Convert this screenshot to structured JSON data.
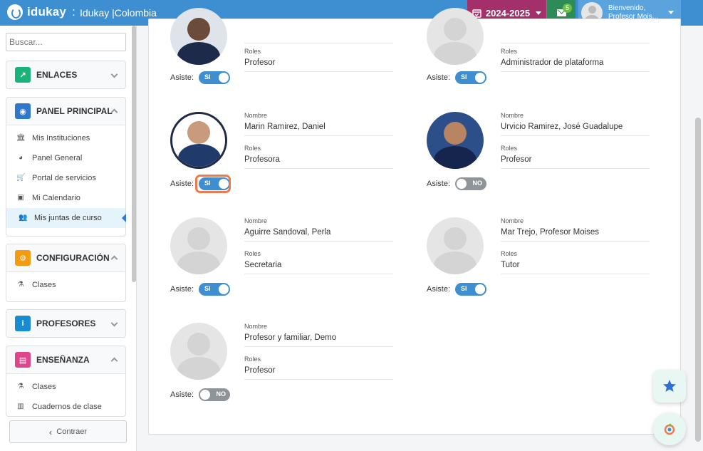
{
  "header": {
    "brand": "idukay",
    "separator": ":",
    "school": "Idukay |Colombia",
    "year": "2024-2025",
    "mail_count": "5",
    "welcome": "Bienvenido,",
    "user_name": "Profesor Mois..."
  },
  "sidebar": {
    "search_placeholder": "Buscar...",
    "back_label": "Contraer",
    "panels": {
      "enlaces": {
        "title": "ENLACES",
        "color": "#1bb37a"
      },
      "principal": {
        "title": "PANEL PRINCIPAL",
        "color": "#2e77c9",
        "items": [
          "Mis Instituciones",
          "Panel General",
          "Portal de servicios",
          "Mi Calendario",
          "Mis juntas de curso"
        ]
      },
      "config": {
        "title": "CONFIGURACIÓN",
        "color": "#f39c12",
        "items": [
          "Clases"
        ]
      },
      "profesores": {
        "title": "PROFESORES",
        "color": "#1a8ad1"
      },
      "ensenanza": {
        "title": "ENSEÑANZA",
        "color": "#e0458c",
        "items": [
          "Clases",
          "Cuadernos de clase"
        ]
      }
    }
  },
  "labels": {
    "nombre": "Nombre",
    "roles": "Roles",
    "asiste": "Asiste:"
  },
  "members": [
    {
      "name": "",
      "role": "Profesor",
      "attends": "SI"
    },
    {
      "name": "",
      "role": "Administrador de plataforma",
      "attends": "SI"
    },
    {
      "name": "Marin Ramirez, Daniel",
      "role": "Profesora",
      "attends": "SI"
    },
    {
      "name": "Urvicio Ramirez, José Guadalupe",
      "role": "Profesor",
      "attends": "NO"
    },
    {
      "name": "Aguirre Sandoval, Perla",
      "role": "Secretaria",
      "attends": "SI"
    },
    {
      "name": "Mar Trejo, Profesor Moises",
      "role": "Tutor",
      "attends": "SI"
    },
    {
      "name": "Profesor y familiar, Demo",
      "role": "Profesor",
      "attends": "NO"
    }
  ],
  "colors": {
    "header": "#3d8fd1",
    "year": "#a3306b",
    "mail": "#2e8b57",
    "toggle_on": "#3d8fd1",
    "toggle_off": "#8f9499",
    "highlight": "#f0784a"
  }
}
